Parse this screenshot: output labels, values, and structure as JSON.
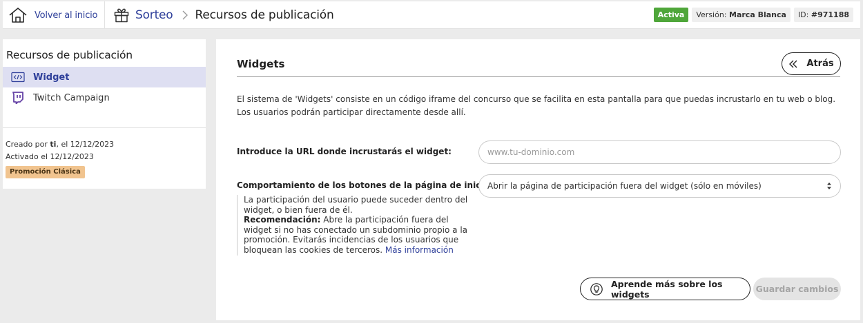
{
  "header": {
    "home_label": "Volver al inicio",
    "breadcrumb_sorteo": "Sorteo",
    "breadcrumb_separator": ">",
    "page_title": "Recursos de publicación",
    "status_badge": "Activa",
    "version_prefix": "Versión: ",
    "version_value": "Marca Blanca",
    "id_prefix": "ID: ",
    "id_value": "#971188"
  },
  "sidebar": {
    "title": "Recursos de publicación",
    "items": [
      {
        "label": "Widget",
        "icon": "code-icon",
        "active": true
      },
      {
        "label": "Twitch Campaign",
        "icon": "twitch-icon",
        "active": false
      }
    ],
    "created_prefix": "Creado por ",
    "created_by": "ti",
    "created_suffix": ", el 12/12/2023",
    "activated": "Activado el 12/12/2023",
    "promo_badge": "Promoción Clásica"
  },
  "main": {
    "title": "Widgets",
    "back_label": "Atrás",
    "intro_line1": "El sistema de 'Widgets' consiste en un código iframe del concurso que se facilita en esta pantalla para que puedas incrustarlo en tu web o blog.",
    "intro_line2": "Los usuarios podrán participar directamente desde allí.",
    "url_label": "Introduce la URL donde incrustarás el widget:",
    "url_placeholder": "www.tu-dominio.com",
    "url_value": "",
    "behavior_label": "Comportamiento de los botones de la página de inicio:",
    "behavior_selected": "Abrir la página de participación fuera del widget (sólo en móviles)",
    "help_text": "La participación del usuario puede suceder dentro del widget, o bien fuera de él.",
    "help_reco_label": "Recomendación:",
    "help_reco_text": " Abre la participación fuera del widget si no has conectado un subdominio propio a la promoción. Evitarás incidencias de los usuarios que bloquean las cookies de terceros. ",
    "help_link": "Más información",
    "learn_button": "Aprende más sobre los widgets",
    "save_button": "Guardar cambios"
  },
  "colors": {
    "brand": "#2e3f9a",
    "active_badge": "#4fa63a",
    "promo_badge": "#f1c48f",
    "sidebar_active_bg": "#dedff2",
    "twitch": "#6441a5"
  }
}
